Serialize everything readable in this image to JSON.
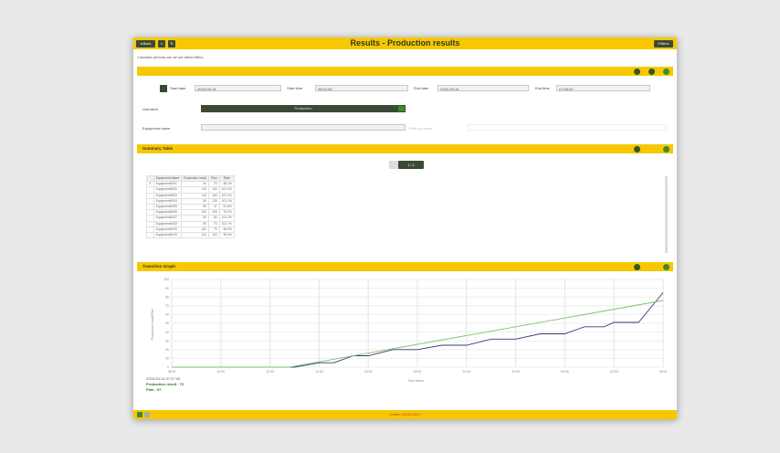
{
  "window": {
    "title": "Results - Production results",
    "back_label": "◂ Back",
    "right_button_label": "Filter ▸",
    "subtitle": "Calculate periods can be set within filters."
  },
  "filter": {
    "start_date_label": "Start date",
    "start_date_value": "2016-09-14",
    "start_time_label": "Start time",
    "start_time_value": "08:02:00",
    "end_date_label": "End date",
    "end_date_value": "2016-09-14",
    "end_time_label": "End time",
    "end_time_value": "07:55:00",
    "unit_label": "Unit label",
    "unit_value": "Production",
    "equipment_label": "Equipment name",
    "equipment_value": "",
    "extra_placeholder": "Filter by name"
  },
  "summary": {
    "title": "Summary Table",
    "paging_label": "1 / 1",
    "columns": [
      "",
      "Equipment Name",
      "Production result",
      "Plan",
      "Rate"
    ],
    "rows": [
      [
        "✔",
        "Equipment0001",
        "40",
        "70",
        "58.1%"
      ],
      [
        "",
        "Equipment0002",
        "110",
        "100",
        "101.1%"
      ],
      [
        "",
        "Equipment0003",
        "110",
        "100",
        "101.1%"
      ],
      [
        "",
        "Equipment0004",
        "90",
        "125",
        "101.1%"
      ],
      [
        "",
        "Equipment0005",
        "90",
        "47",
        "91.6%"
      ],
      [
        "",
        "Equipment0006",
        "110",
        "100",
        "75.2%"
      ],
      [
        "",
        "Equipment0007",
        "90",
        "60",
        "101.1%"
      ],
      [
        "",
        "Equipment0008",
        "90",
        "70",
        "101.7%"
      ],
      [
        "",
        "Equipment0009",
        "100",
        "70",
        "96.2%"
      ],
      [
        "",
        "Equipment0010",
        "110",
        "100",
        "98.4%"
      ]
    ]
  },
  "graph": {
    "title": "Transition Graph",
    "legend_time": "2016-09-14 07:07:00",
    "legend_result": "Production result : 72",
    "legend_plan": "Plan : 57",
    "ylabel": "Production result/Plan",
    "xlabel": "Time series",
    "colors": {
      "result": "#3b3a6e",
      "plan": "#7dbf6a"
    }
  },
  "chart_data": {
    "type": "line",
    "title": "",
    "xlabel": "Time series",
    "ylabel": "Production result/Plan",
    "x_ticks": [
      "08:00",
      "10:00",
      "12:00",
      "14:00",
      "16:00",
      "18:00",
      "20:00",
      "22:00",
      "00:00",
      "02:00",
      "04:00"
    ],
    "y_ticks": [
      "0",
      "10",
      "20",
      "30",
      "40",
      "50",
      "60",
      "70",
      "80",
      "90",
      "100"
    ],
    "ylim": [
      0,
      100
    ],
    "series": [
      {
        "name": "Production result",
        "x": [
          0,
          2.5,
          3,
          3.3,
          3.7,
          4,
          4.5,
          5,
          5.5,
          6,
          6.5,
          7,
          7.5,
          8,
          8.4,
          8.8,
          9,
          9.5,
          10
        ],
        "values": [
          0,
          0,
          5,
          5,
          13,
          13,
          20,
          20,
          25,
          25,
          32,
          32,
          38,
          38,
          46,
          46,
          51,
          51,
          85
        ]
      },
      {
        "name": "Plan",
        "x": [
          0,
          2.4,
          10
        ],
        "values": [
          0,
          0,
          76
        ]
      }
    ]
  },
  "footer": {
    "status_text": "Online  |  30/11/2017"
  }
}
